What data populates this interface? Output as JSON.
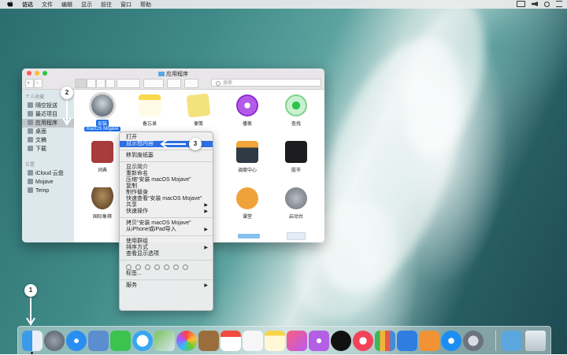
{
  "menubar": {
    "items": [
      "访达",
      "文件",
      "编辑",
      "显示",
      "前往",
      "窗口",
      "帮助"
    ]
  },
  "finder": {
    "title": "应用程序",
    "search_placeholder": "搜索",
    "sidebar": {
      "favorites_header": "个人收藏",
      "favorites": [
        "隔空投送",
        "最近项目",
        "应用程序",
        "桌面",
        "文稿",
        "下载"
      ],
      "locations_header": "位置",
      "locations": [
        "iCloud 云盘",
        "Mojave",
        "Temp"
      ]
    },
    "apps": {
      "installer": {
        "line1": "安装",
        "line2": "macOS Mojave"
      },
      "notes": "备忘录",
      "stickies": "便笺",
      "podcasts": "播客",
      "findmy": "查找",
      "dictionary": "词典",
      "mission_control": "调度中心",
      "stocks": "股市",
      "chess": "国际象棋",
      "classroom": "课堂",
      "launchpad": "启动台"
    }
  },
  "context_menu": {
    "items": [
      "打开",
      "显示包内容",
      "移到废纸篓",
      "显示简介",
      "重新命名",
      "压缩“安装 macOS Mojave”",
      "复制",
      "制作替身",
      "快速查看“安装 macOS Mojave”",
      "共享",
      "快速操作",
      "拷贝“安装 macOS Mojave”",
      "从iPhone或iPad导入",
      "使用群组",
      "排序方式",
      "查看显示选项",
      "标签...",
      "服务"
    ]
  },
  "annotations": {
    "one": "1",
    "two": "2",
    "three": "3"
  },
  "colors": {
    "highlight": "#2c6fe3",
    "selected_label": "#1b6ee8"
  }
}
